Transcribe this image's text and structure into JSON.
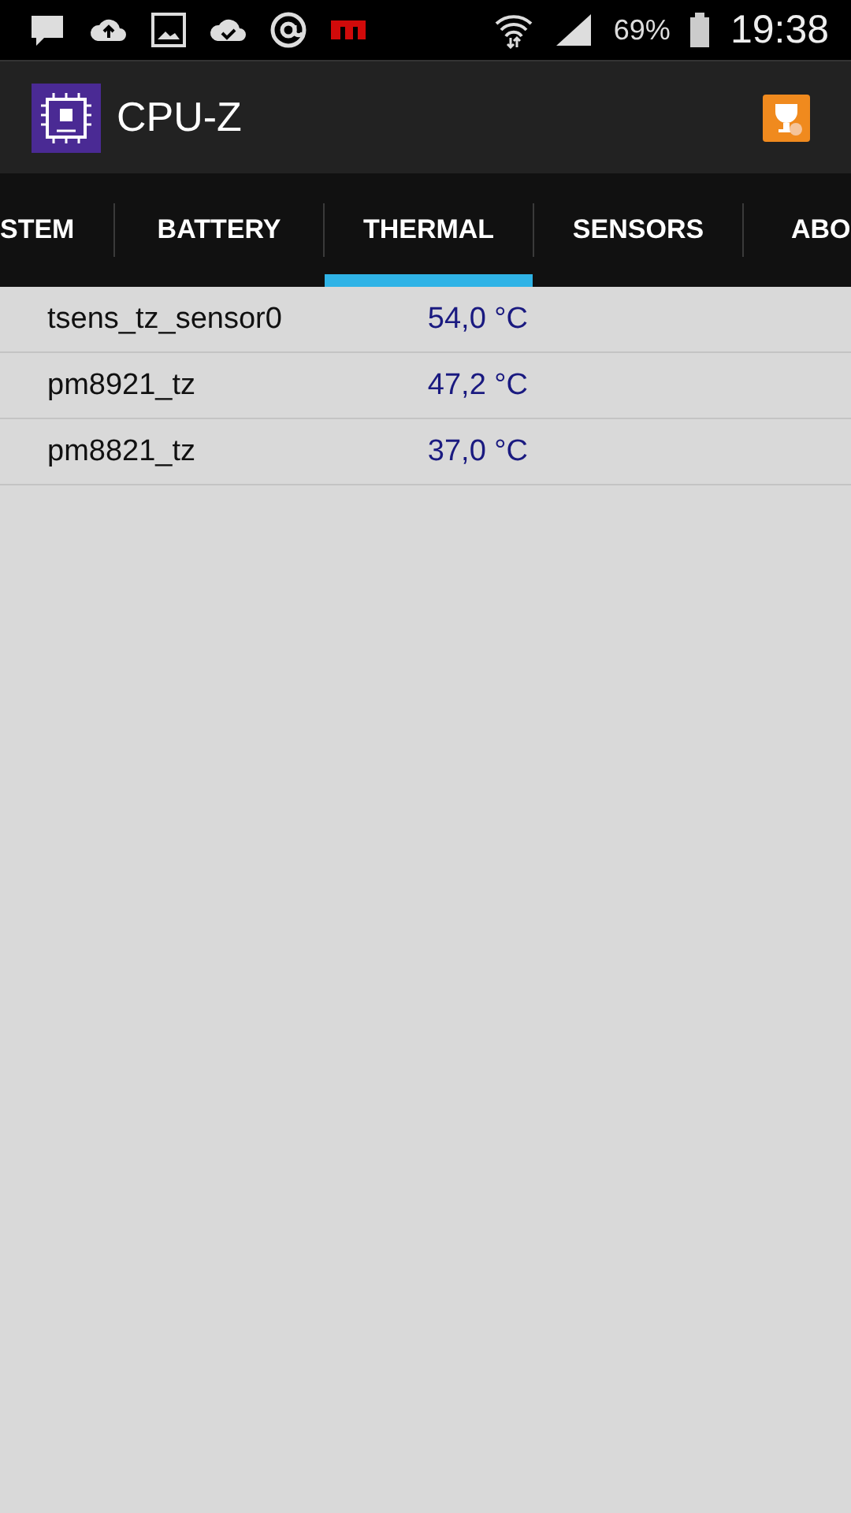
{
  "status_bar": {
    "battery": "69%",
    "time": "19:38"
  },
  "app_bar": {
    "title": "CPU-Z"
  },
  "tabs": [
    {
      "label": "STEM",
      "selected": false
    },
    {
      "label": "BATTERY",
      "selected": false
    },
    {
      "label": "THERMAL",
      "selected": true
    },
    {
      "label": "SENSORS",
      "selected": false
    },
    {
      "label": "ABO",
      "selected": false
    }
  ],
  "rows": [
    {
      "name": "tsens_tz_sensor0",
      "value": "54,0 °C"
    },
    {
      "name": "pm8921_tz",
      "value": "47,2 °C"
    },
    {
      "name": "pm8821_tz",
      "value": "37,0 °C"
    }
  ]
}
